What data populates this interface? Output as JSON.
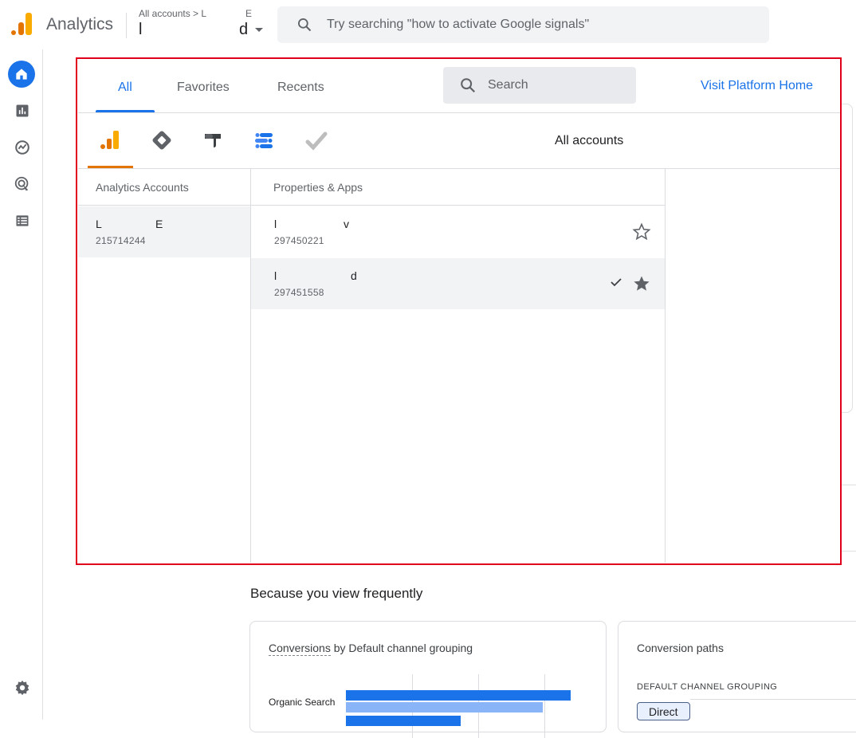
{
  "header": {
    "app_title": "Analytics",
    "breadcrumb_prefix": "All accounts >",
    "breadcrumb_account_start": "L",
    "breadcrumb_account_end": "E",
    "property_start": "l",
    "property_end": "d",
    "search_placeholder": "Try searching \"how to activate Google signals\""
  },
  "picker": {
    "tabs": [
      "All",
      "Favorites",
      "Recents"
    ],
    "active_tab": "All",
    "search_placeholder": "Search",
    "visit_link": "Visit Platform Home",
    "products": [
      "analytics-icon",
      "tag-manager-icon",
      "optimize-icon",
      "data-studio-icon",
      "surveys-icon"
    ],
    "scope_label": "All accounts",
    "accounts_header": "Analytics Accounts",
    "properties_header": "Properties & Apps",
    "accounts": [
      {
        "name_start": "L",
        "name_end": "E",
        "id": "215714244"
      }
    ],
    "properties": [
      {
        "name_start": "l",
        "name_end": "v",
        "id": "297450221",
        "starred": false,
        "selected": false
      },
      {
        "name_start": "l",
        "name_end": "d",
        "id": "297451558",
        "starred": true,
        "selected": true
      }
    ]
  },
  "main": {
    "section_title": "Because you view frequently",
    "card1": {
      "title_link": "Conversions",
      "title_rest": " by Default channel grouping",
      "row_label": "Organic Search"
    },
    "card2": {
      "title": "Conversion paths",
      "subtitle": "DEFAULT CHANNEL GROUPING",
      "chip": "Direct"
    }
  },
  "colors": {
    "accent": "#1a73e8",
    "highlight": "#e0001b",
    "analytics_orange": "#f9ab00",
    "analytics_dark": "#e37400"
  }
}
